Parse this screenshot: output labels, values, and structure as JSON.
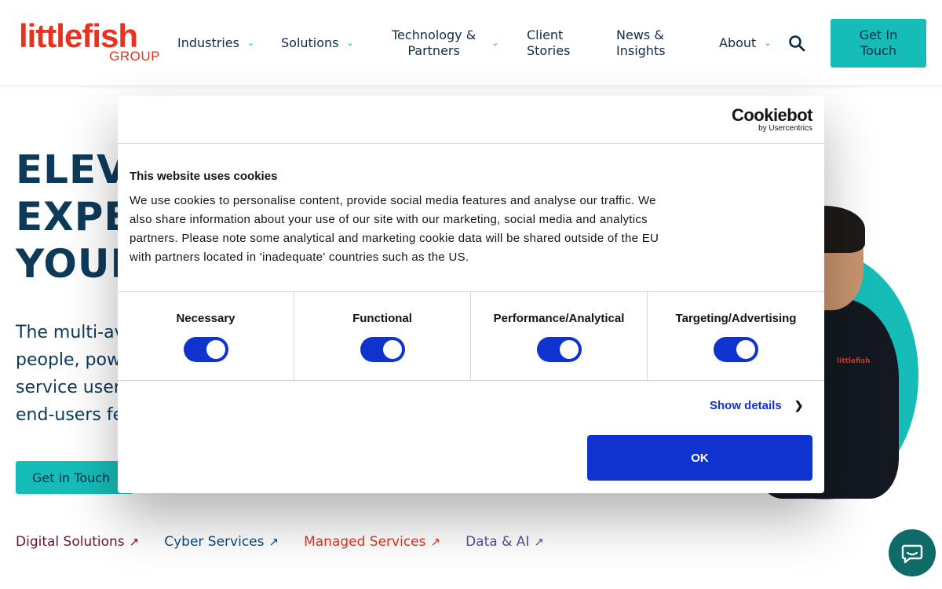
{
  "logo": {
    "main": "littlefish",
    "sub": "GROUP"
  },
  "nav": {
    "industries": "Industries",
    "solutions": "Solutions",
    "technology_line1": "Technology &",
    "technology_line2": "Partners",
    "client_line1": "Client",
    "client_line2": "Stories",
    "news_line1": "News &",
    "news_line2": "Insights",
    "about": "About",
    "cta_line1": "Get In",
    "cta_line2": "Touch"
  },
  "hero": {
    "title_line1": "ELEVA",
    "title_line2": "EXPE",
    "title_line3": "YOUR",
    "body_line1": "The multi-av",
    "body_line2": "people, powe",
    "body_line3": "service users",
    "body_line4": "end-users fe",
    "cta": "Get in Touch",
    "shirt_logo": "littlefish"
  },
  "bottom_links": [
    {
      "label": "Digital Solutions",
      "arrow": "↗",
      "color": "#6b1238"
    },
    {
      "label": "Cyber Services",
      "arrow": "↗",
      "color": "#0e4a7a"
    },
    {
      "label": "Managed Services",
      "arrow": "↗",
      "color": "#e6321e"
    },
    {
      "label": "Data & AI",
      "arrow": "↗",
      "color": "#5b4e9a"
    }
  ],
  "cookie": {
    "brand_name": "Cookiebot",
    "brand_sub": "by Usercentrics",
    "heading": "This website uses cookies",
    "text": "We use cookies to personalise content, provide social media features and analyse our traffic. We also share information about your use of our site with our marketing, social media and analytics partners. Please note some analytical and marketing cookie data will be shared outside of the EU with partners located in 'inadequate' countries such as the US.",
    "categories": [
      {
        "label": "Necessary",
        "enabled": true
      },
      {
        "label": "Functional",
        "enabled": true
      },
      {
        "label": "Performance/Analytical",
        "enabled": true
      },
      {
        "label": "Targeting/Advertising",
        "enabled": true
      }
    ],
    "show_details": "Show details",
    "ok": "OK"
  },
  "colors": {
    "brand_red": "#e6321e",
    "teal": "#16bdb8",
    "navy": "#0e2b4a",
    "cookie_blue": "#1032cf"
  },
  "icons": {
    "search": "search-icon",
    "chevron": "chevron-down-icon",
    "chat": "chat-icon"
  }
}
